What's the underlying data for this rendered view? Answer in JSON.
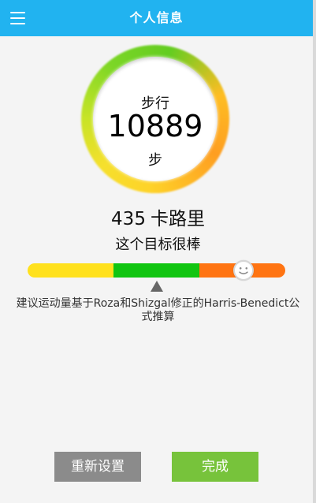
{
  "header": {
    "title": "个人信息",
    "menu_icon": "menu-icon",
    "background": "#21b3f0"
  },
  "steps": {
    "label": "步行",
    "value": "10889",
    "unit": "步",
    "ring_colors": [
      "#ff9a16",
      "#ffd21f",
      "#76d51b",
      "#5ccb16"
    ]
  },
  "calories": {
    "value": "435",
    "unit": "卡路里"
  },
  "goal": {
    "message": "这个目标很棒",
    "scale_colors": [
      "#ffe11d",
      "#11c511",
      "#ff7412"
    ],
    "indicator_icon": "smiley-icon",
    "marker_icon": "triangle-up-icon"
  },
  "info": {
    "text": "建议运动量基于Roza和Shizgal修正的Harris-Benedict公式推算"
  },
  "buttons": {
    "reset": "重新设置",
    "done": "完成"
  }
}
